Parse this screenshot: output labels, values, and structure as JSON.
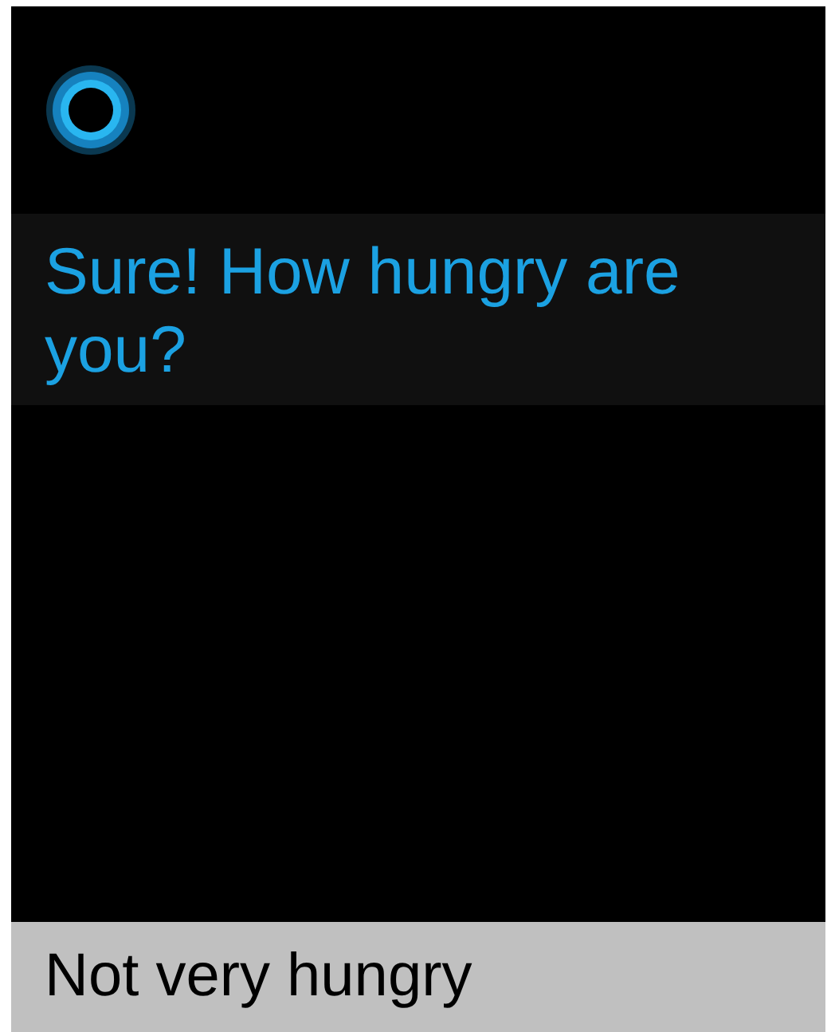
{
  "prompt": {
    "text": "Sure! How hungry are you?"
  },
  "suggestion": {
    "text": "Not very hungry"
  }
}
